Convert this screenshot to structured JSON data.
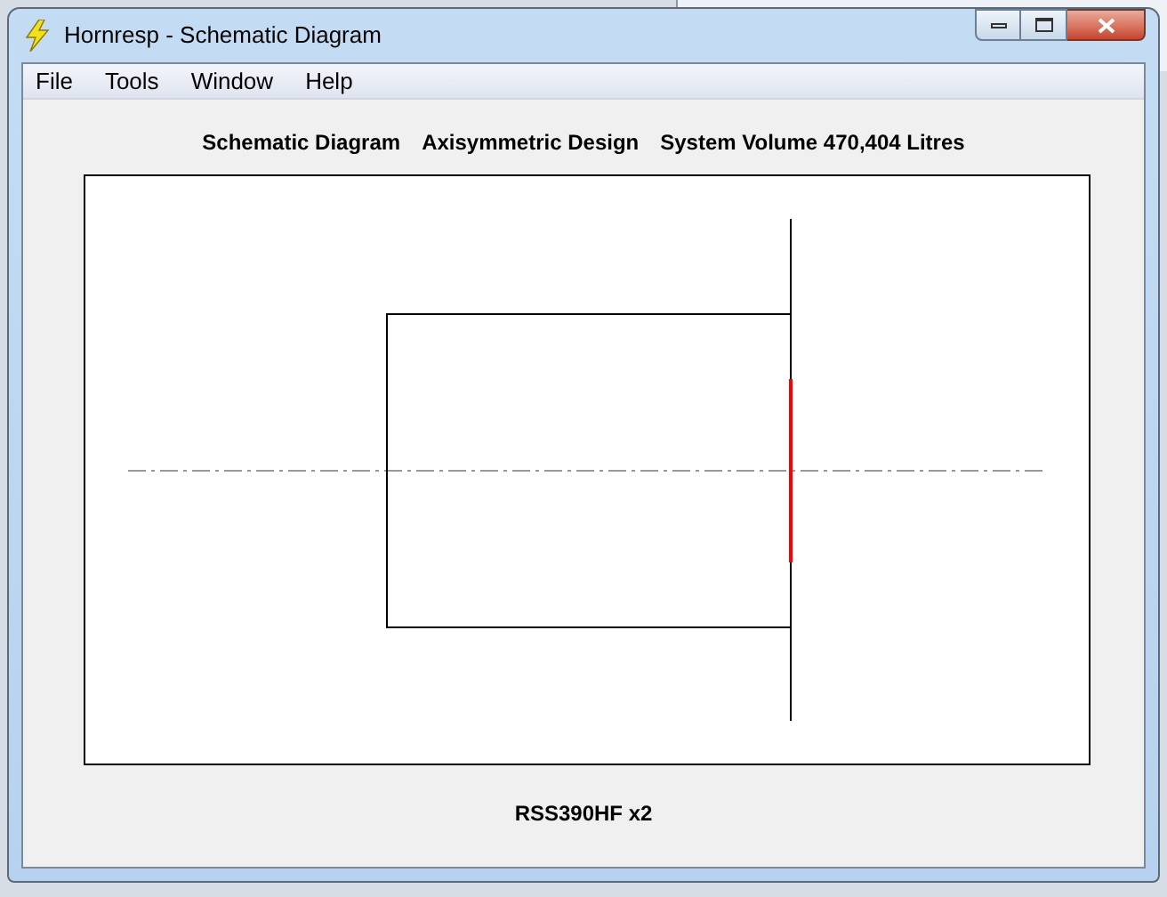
{
  "window": {
    "title": "Hornresp - Schematic Diagram"
  },
  "menu": [
    "File",
    "Tools",
    "Window",
    "Help"
  ],
  "header": [
    "Schematic Diagram",
    "Axisymmetric Design",
    "System Volume 470,404 Litres"
  ],
  "footer": "RSS390HF x2"
}
